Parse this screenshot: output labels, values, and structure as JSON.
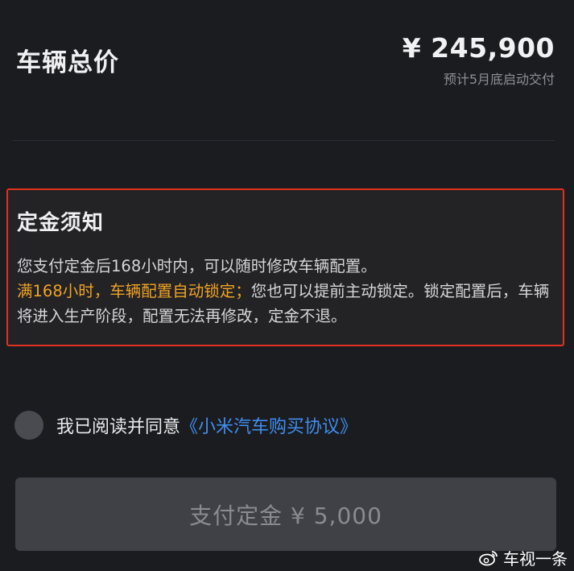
{
  "summary": {
    "total_label": "车辆总价",
    "price": "¥ 245,900",
    "delivery_note": "预计5月底启动交付"
  },
  "notice": {
    "title": "定金须知",
    "line1": "您支付定金后168小时内，可以随时修改车辆配置。",
    "highlight": "满168小时，车辆配置自动锁定；",
    "rest": "您也可以提前主动锁定。锁定配置后，车辆将进入生产阶段，配置无法再修改，定金不退。",
    "highlight_color": "#f0a324",
    "border_color": "#e0321f"
  },
  "agreement": {
    "text": "我已阅读并同意",
    "link": "《小米汽车购买协议》",
    "checked": false
  },
  "pay_button": {
    "label": "支付定金 ¥ 5,000",
    "enabled": false
  },
  "watermark": {
    "icon": "weibo-icon",
    "text": "车视一条"
  }
}
